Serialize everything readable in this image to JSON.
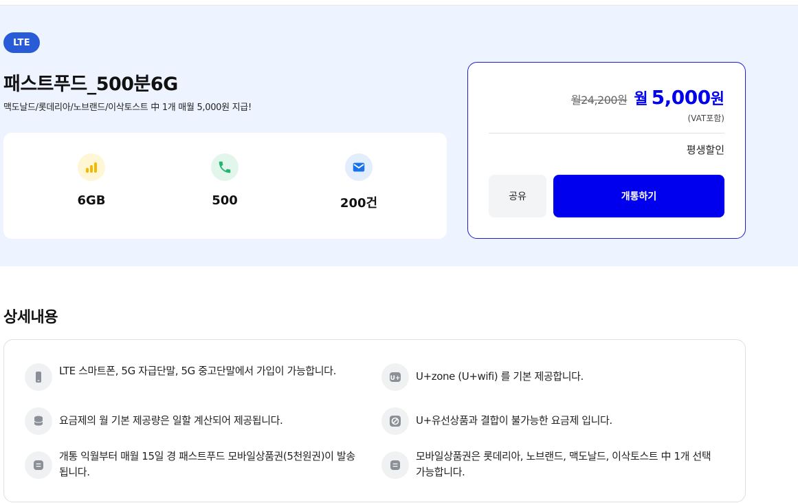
{
  "plan": {
    "badge": "LTE",
    "title": "패스트푸드_500분6G",
    "subtitle": "맥도날드/롯데리아/노브랜드/이삭토스트 中 1개 매월 5,000원 지급!"
  },
  "stats": [
    {
      "icon": "signal-bars-icon",
      "value": "6GB",
      "color": "#f5b800"
    },
    {
      "icon": "phone-icon",
      "value": "500",
      "color": "#22b573"
    },
    {
      "icon": "mail-icon",
      "value": "200건",
      "color": "#1a73e8"
    }
  ],
  "price": {
    "original": "월24,200원",
    "prefix": "월",
    "amount": "5,000",
    "unit": "원",
    "vat": "(VAT포함)",
    "discount": "평생할인"
  },
  "buttons": {
    "share": "공유",
    "open": "개통하기"
  },
  "details": {
    "title": "상세내용",
    "items": [
      {
        "icon": "phone-device-icon",
        "text": "LTE 스마트폰, 5G 자급단말, 5G 중고단말에서 가입이 가능합니다."
      },
      {
        "icon": "uzone-wifi-icon",
        "text": "U+zone (U+wifi) 를 기본 제공합니다."
      },
      {
        "icon": "database-icon",
        "text": "요금제의 월 기본 제공량은 일할 계산되어 제공됩니다."
      },
      {
        "icon": "no-combine-icon",
        "text": "U+유선상품과 결합이 불가능한 요금제 입니다."
      },
      {
        "icon": "document-icon",
        "text": "개통 익월부터 매월 15일 경 패스트푸드 모바일상품권(5천원권)이 발송됩니다."
      },
      {
        "icon": "document-icon",
        "text": "모바일상품권은 롯데리아, 노브랜드, 맥도날드, 이삭토스트 中 1개 선택 가능합니다."
      }
    ]
  },
  "colors": {
    "accent": "#0000ee",
    "badge": "#2a5bd7",
    "hero_bg": "#eef4ff"
  }
}
